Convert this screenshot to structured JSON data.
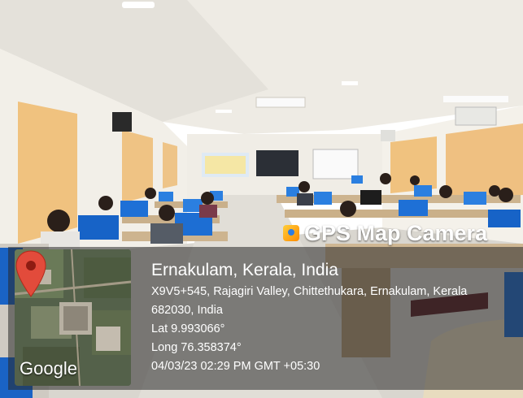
{
  "watermark": {
    "app_name": "GPS Map Camera",
    "icon": "gps-map-camera-app-icon"
  },
  "map": {
    "logo_text": "Google",
    "pin_icon": "map-pin-icon"
  },
  "location": {
    "place": "Ernakulam, Kerala, India",
    "address_line1": "X9V5+545, Rajagiri Valley, Chittethukara, Ernakulam, Kerala",
    "address_line2": "682030, India",
    "latitude": "Lat 9.993066°",
    "longitude": "Long 76.358374°",
    "datetime": "04/03/23 02:29 PM GMT +05:30"
  },
  "scene": {
    "wall_color": "#f2efe8",
    "curtain_color": "#f0c27f",
    "floor_color": "#d9d6cf",
    "pin_color": "#e24b3b"
  }
}
